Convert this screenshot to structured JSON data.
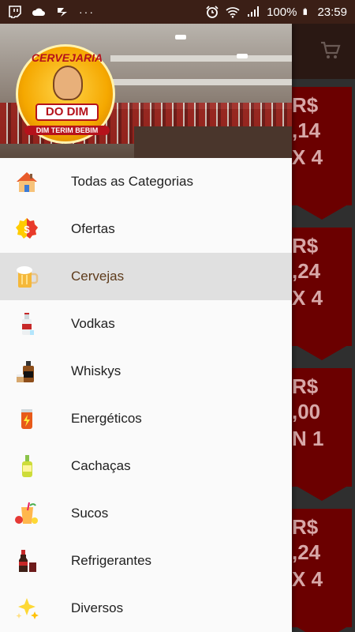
{
  "status_bar": {
    "battery": "100%",
    "time": "23:59",
    "overflow": "···"
  },
  "drawer": {
    "logo": {
      "top_text": "CERVEJARIA",
      "banner_text": "DO DIM",
      "bottom_text": "DIM TERIM BEBIM"
    },
    "menu": [
      {
        "label": "Todas as Categorias",
        "icon": "house-icon",
        "active": false
      },
      {
        "label": "Ofertas",
        "icon": "price-tag-icon",
        "active": false
      },
      {
        "label": "Cervejas",
        "icon": "beer-mug-icon",
        "active": true
      },
      {
        "label": "Vodkas",
        "icon": "vodka-bottle-icon",
        "active": false
      },
      {
        "label": "Whiskys",
        "icon": "whisky-icon",
        "active": false
      },
      {
        "label": "Energéticos",
        "icon": "energy-can-icon",
        "active": false
      },
      {
        "label": "Cachaças",
        "icon": "cachaca-bottle-icon",
        "active": false
      },
      {
        "label": "Sucos",
        "icon": "juice-icon",
        "active": false
      },
      {
        "label": "Refrigerantes",
        "icon": "soda-icon",
        "active": false
      },
      {
        "label": "Diversos",
        "icon": "sparkles-icon",
        "active": false
      }
    ]
  },
  "background_promos": [
    {
      "line1": "R$",
      "line2": ",14",
      "line3": "X 4"
    },
    {
      "line1": "R$",
      "line2": ",24",
      "line3": "X 4"
    },
    {
      "line1": "R$",
      "line2": ",00",
      "line3": "N 1"
    },
    {
      "line1": "R$",
      "line2": ",24",
      "line3": "X 4"
    }
  ],
  "colors": {
    "status_bar": "#3b1f16",
    "active_item_bg": "#e0e0e0",
    "promo_red": "#6b0000"
  }
}
